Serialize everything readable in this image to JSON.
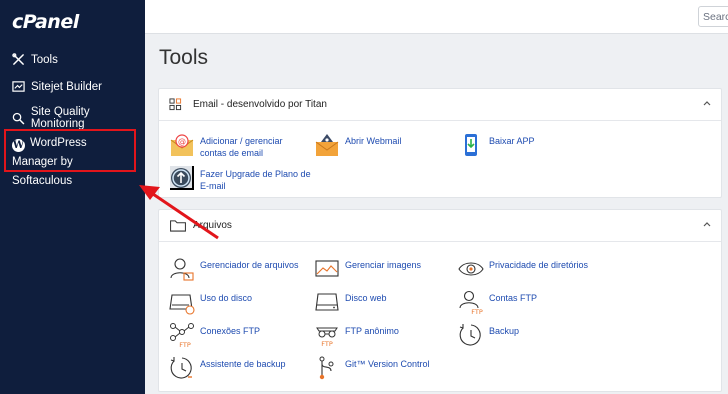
{
  "app": {
    "logo": "cPanel"
  },
  "sidebar": {
    "items": [
      {
        "label": "Tools"
      },
      {
        "label": "Sitejet Builder"
      },
      {
        "label": "Site Quality Monitoring"
      },
      {
        "label": "WordPress Manager by Softaculous"
      }
    ]
  },
  "search": {
    "placeholder": "Search"
  },
  "page": {
    "title": "Tools"
  },
  "email_panel": {
    "title": "Email - desenvolvido por Titan",
    "tools": [
      {
        "label": "Adicionar / gerenciar contas de email",
        "icon": "mail-add-icon"
      },
      {
        "label": "Abrir Webmail",
        "icon": "webmail-icon"
      },
      {
        "label": "Baixar APP",
        "icon": "mobile-download-icon"
      },
      {
        "label": "Fazer Upgrade de Plano de E-mail",
        "icon": "upgrade-icon"
      }
    ]
  },
  "files_panel": {
    "title": "Arquivos",
    "tools": [
      {
        "label": "Gerenciador de arquivos",
        "icon": "file-manager-icon"
      },
      {
        "label": "Gerenciar imagens",
        "icon": "images-icon"
      },
      {
        "label": "Privacidade de diretórios",
        "icon": "eye-icon"
      },
      {
        "label": "Uso do disco",
        "icon": "disk-usage-icon"
      },
      {
        "label": "Disco web",
        "icon": "web-disk-icon"
      },
      {
        "label": "Contas FTP",
        "icon": "ftp-accounts-icon"
      },
      {
        "label": "Conexões FTP",
        "icon": "ftp-connections-icon"
      },
      {
        "label": "FTP anônimo",
        "icon": "anonymous-ftp-icon"
      },
      {
        "label": "Backup",
        "icon": "backup-icon"
      },
      {
        "label": "Assistente de backup",
        "icon": "backup-wizard-icon"
      },
      {
        "label": "Git™ Version Control",
        "icon": "git-icon"
      }
    ]
  },
  "colors": {
    "sidebar_bg": "#0f1e3d",
    "link": "#1e4bb0",
    "highlight": "#e2151b",
    "ftp_orange": "#e8742a"
  }
}
